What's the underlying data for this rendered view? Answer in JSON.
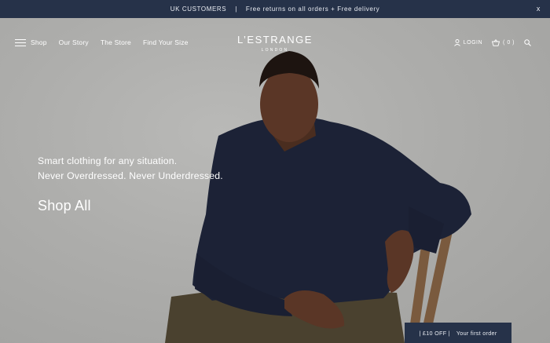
{
  "announcement": {
    "region": "UK CUSTOMERS",
    "separator": "|",
    "message": "Free returns on all orders + Free delivery",
    "close": "x"
  },
  "nav": {
    "menu_label": "Shop",
    "links": [
      "Our Story",
      "The Store",
      "Find Your Size"
    ],
    "brand": "L’ESTRANGE",
    "brand_sub": "LONDON",
    "login": "LOGIN",
    "cart_count": "( 0 )"
  },
  "hero": {
    "line1": "Smart clothing for any situation.",
    "line2": "Never Overdressed. Never Underdressed.",
    "cta": "Shop All"
  },
  "promo": {
    "code": "| £10 OFF |",
    "text": "Your first order"
  },
  "colors": {
    "navy": "#263249",
    "background": "#a9a9a7",
    "text_light": "#ffffff"
  },
  "icons": [
    "hamburger-icon",
    "user-icon",
    "basket-icon",
    "search-icon",
    "close-icon"
  ]
}
